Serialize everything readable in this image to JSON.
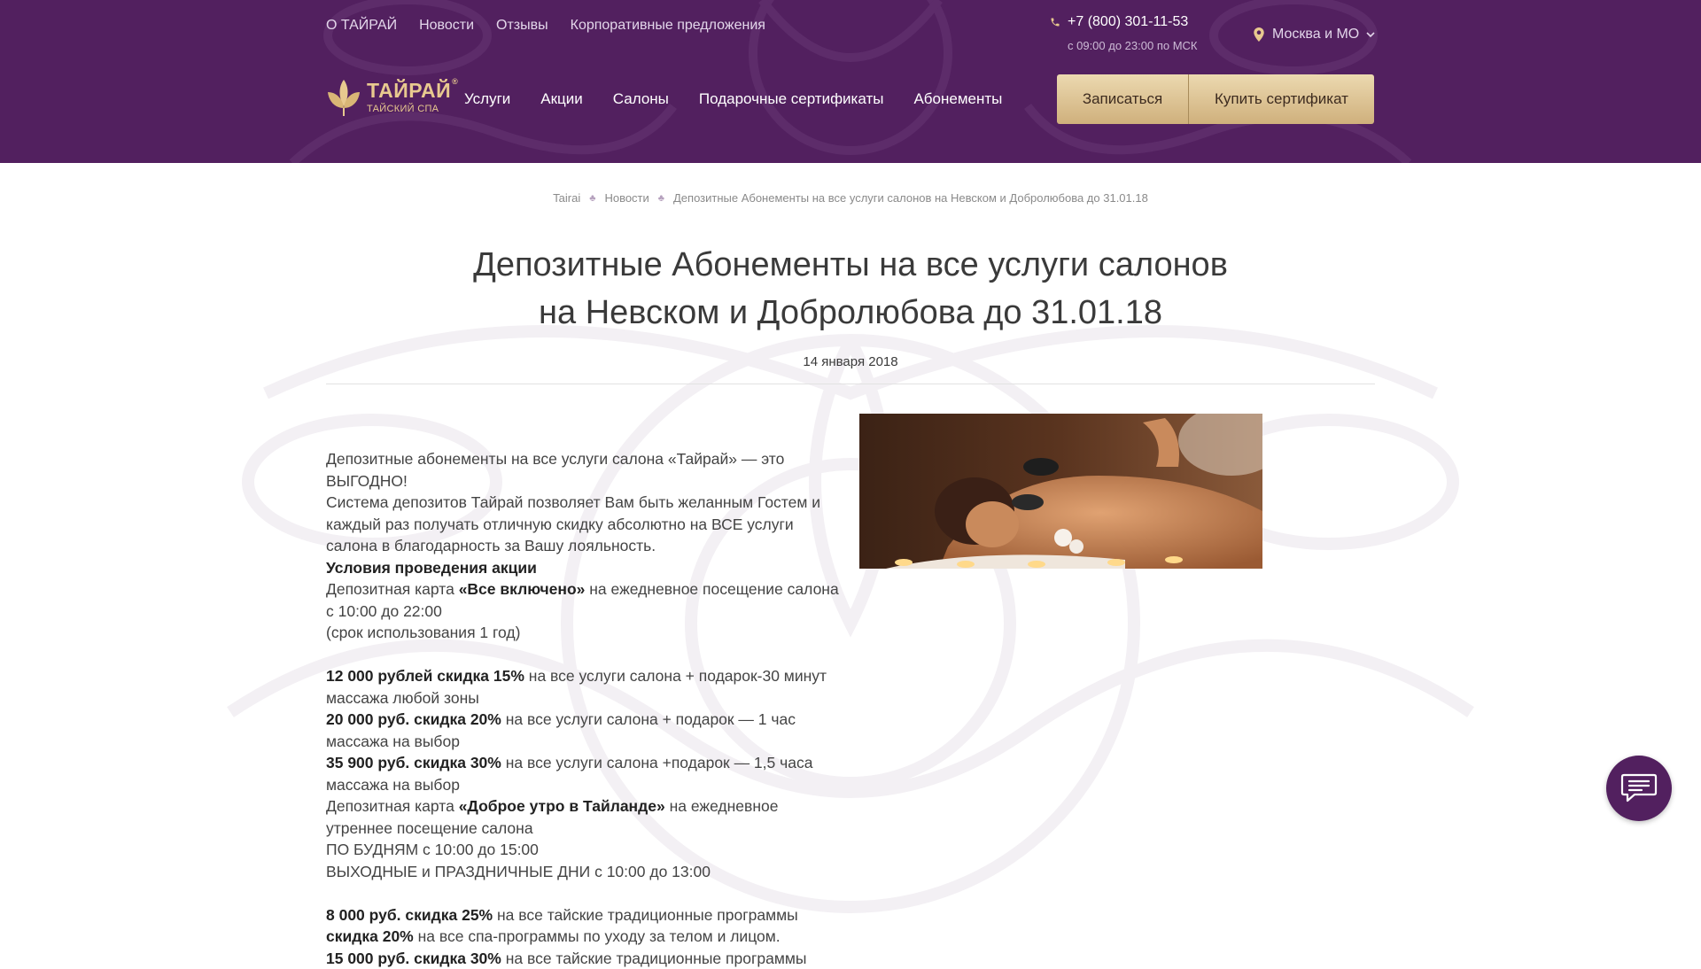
{
  "colors": {
    "header_bg": "#52205f",
    "accent_gold": "#e8c98f",
    "button_gold": "#d9bf8c"
  },
  "header": {
    "top_links": [
      "О ТАЙРАЙ",
      "Новости",
      "Отзывы",
      "Корпоративные предложения"
    ],
    "phone": "+7 (800) 301-11-53",
    "phone_hours": "с 09:00 до 23:00 по МСК",
    "city": "Москва и МО",
    "logo": {
      "name": "ТАЙРАЙ",
      "registered": "®",
      "subtitle": "ТАЙСКИЙ СПА"
    },
    "nav": [
      "Услуги",
      "Акции",
      "Салоны",
      "Подарочные сертификаты",
      "Абонементы"
    ],
    "book_button": "Записаться",
    "cert_button": "Купить сертификат",
    "icons": {
      "phone": "phone-icon",
      "location": "location-pin-icon",
      "dropdown": "chevron-down-icon"
    }
  },
  "breadcrumb": [
    "Tairai",
    "Новости",
    "Депозитные Абонементы на все услуги салонов на Невском и Добролюбова до 31.01.18"
  ],
  "article": {
    "title_line1": "Депозитные Абонементы на все услуги салонов",
    "title_line2": "на Невском и Добролюбова до 31.01.18",
    "date": "14 января 2018",
    "p1": "Депозитные абонементы на все услуги салона «Тайрай» — это ВЫГОДНО!",
    "p2": "Система депозитов Тайрай позволяет Вам быть желанным Гостем и каждый раз получать отличную скидку абсолютно на ВСЕ услуги салона в благодарность за Вашу лояльность.",
    "conditions": "Условия проведения акции",
    "card1_pre": "Депозитная карта ",
    "card1_name": "«Все включено»",
    "card1_post": " на ежедневное посещение салона с 10:00 до 22:00",
    "card1_term": "(срок использования 1 год)",
    "offer1_bold": "12 000 рублей скидка 15%",
    "offer1_text": " на все услуги салона + подарок-30 минут массажа любой зоны",
    "offer2_bold": "20 000 руб. скидка 20%",
    "offer2_text": " на все услуги салона + подарок — 1 час массажа на выбор",
    "offer3_bold": "35 900 руб. скидка 30%",
    "offer3_text": " на все услуги салона +подарок — 1,5 часа массажа на выбор",
    "card2_pre": "Депозитная карта ",
    "card2_name": "«Доброе утро в Тайланде»",
    "card2_post": " на ежедневное утреннее посещение салона",
    "weekdays": "ПО БУДНЯМ с 10:00 до 15:00",
    "weekends": "ВЫХОДНЫЕ и ПРАЗДНИЧНЫЕ ДНИ с 10:00 до 13:00",
    "offer4_bold": "8 000 руб. скидка 25%",
    "offer4_text": " на все тайские традиционные программы",
    "offer5_bold": "скидка 20%",
    "offer5_text": " на все спа-программы по уходу за телом и лицом.",
    "offer6_bold": "15 000 руб. скидка 30%",
    "offer6_text": " на все тайские традиционные программы"
  }
}
